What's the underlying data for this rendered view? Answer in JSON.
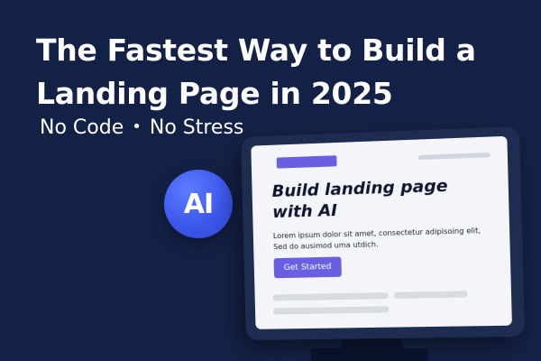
{
  "hero": {
    "title_line_1": "The Fastest Way to Build a",
    "title_line_2": "Landing Page in 2025",
    "subtitle_part_1": "No Code",
    "subtitle_separator": "•",
    "subtitle_part_2": "No Stress"
  },
  "badge": {
    "label": "AI",
    "color": "#3d57ec"
  },
  "mockup": {
    "heading": "Build landing page with AI",
    "body": "Lorem ipsum dolor sit amet, consectetur adipisoing elit, Sed do ausimod uma utdich.",
    "cta_label": "Get Started",
    "accent_color": "#6a5fe3"
  },
  "colors": {
    "background": "#142146",
    "monitor_frame": "#1e2c52",
    "screen": "#f4f5f8"
  }
}
